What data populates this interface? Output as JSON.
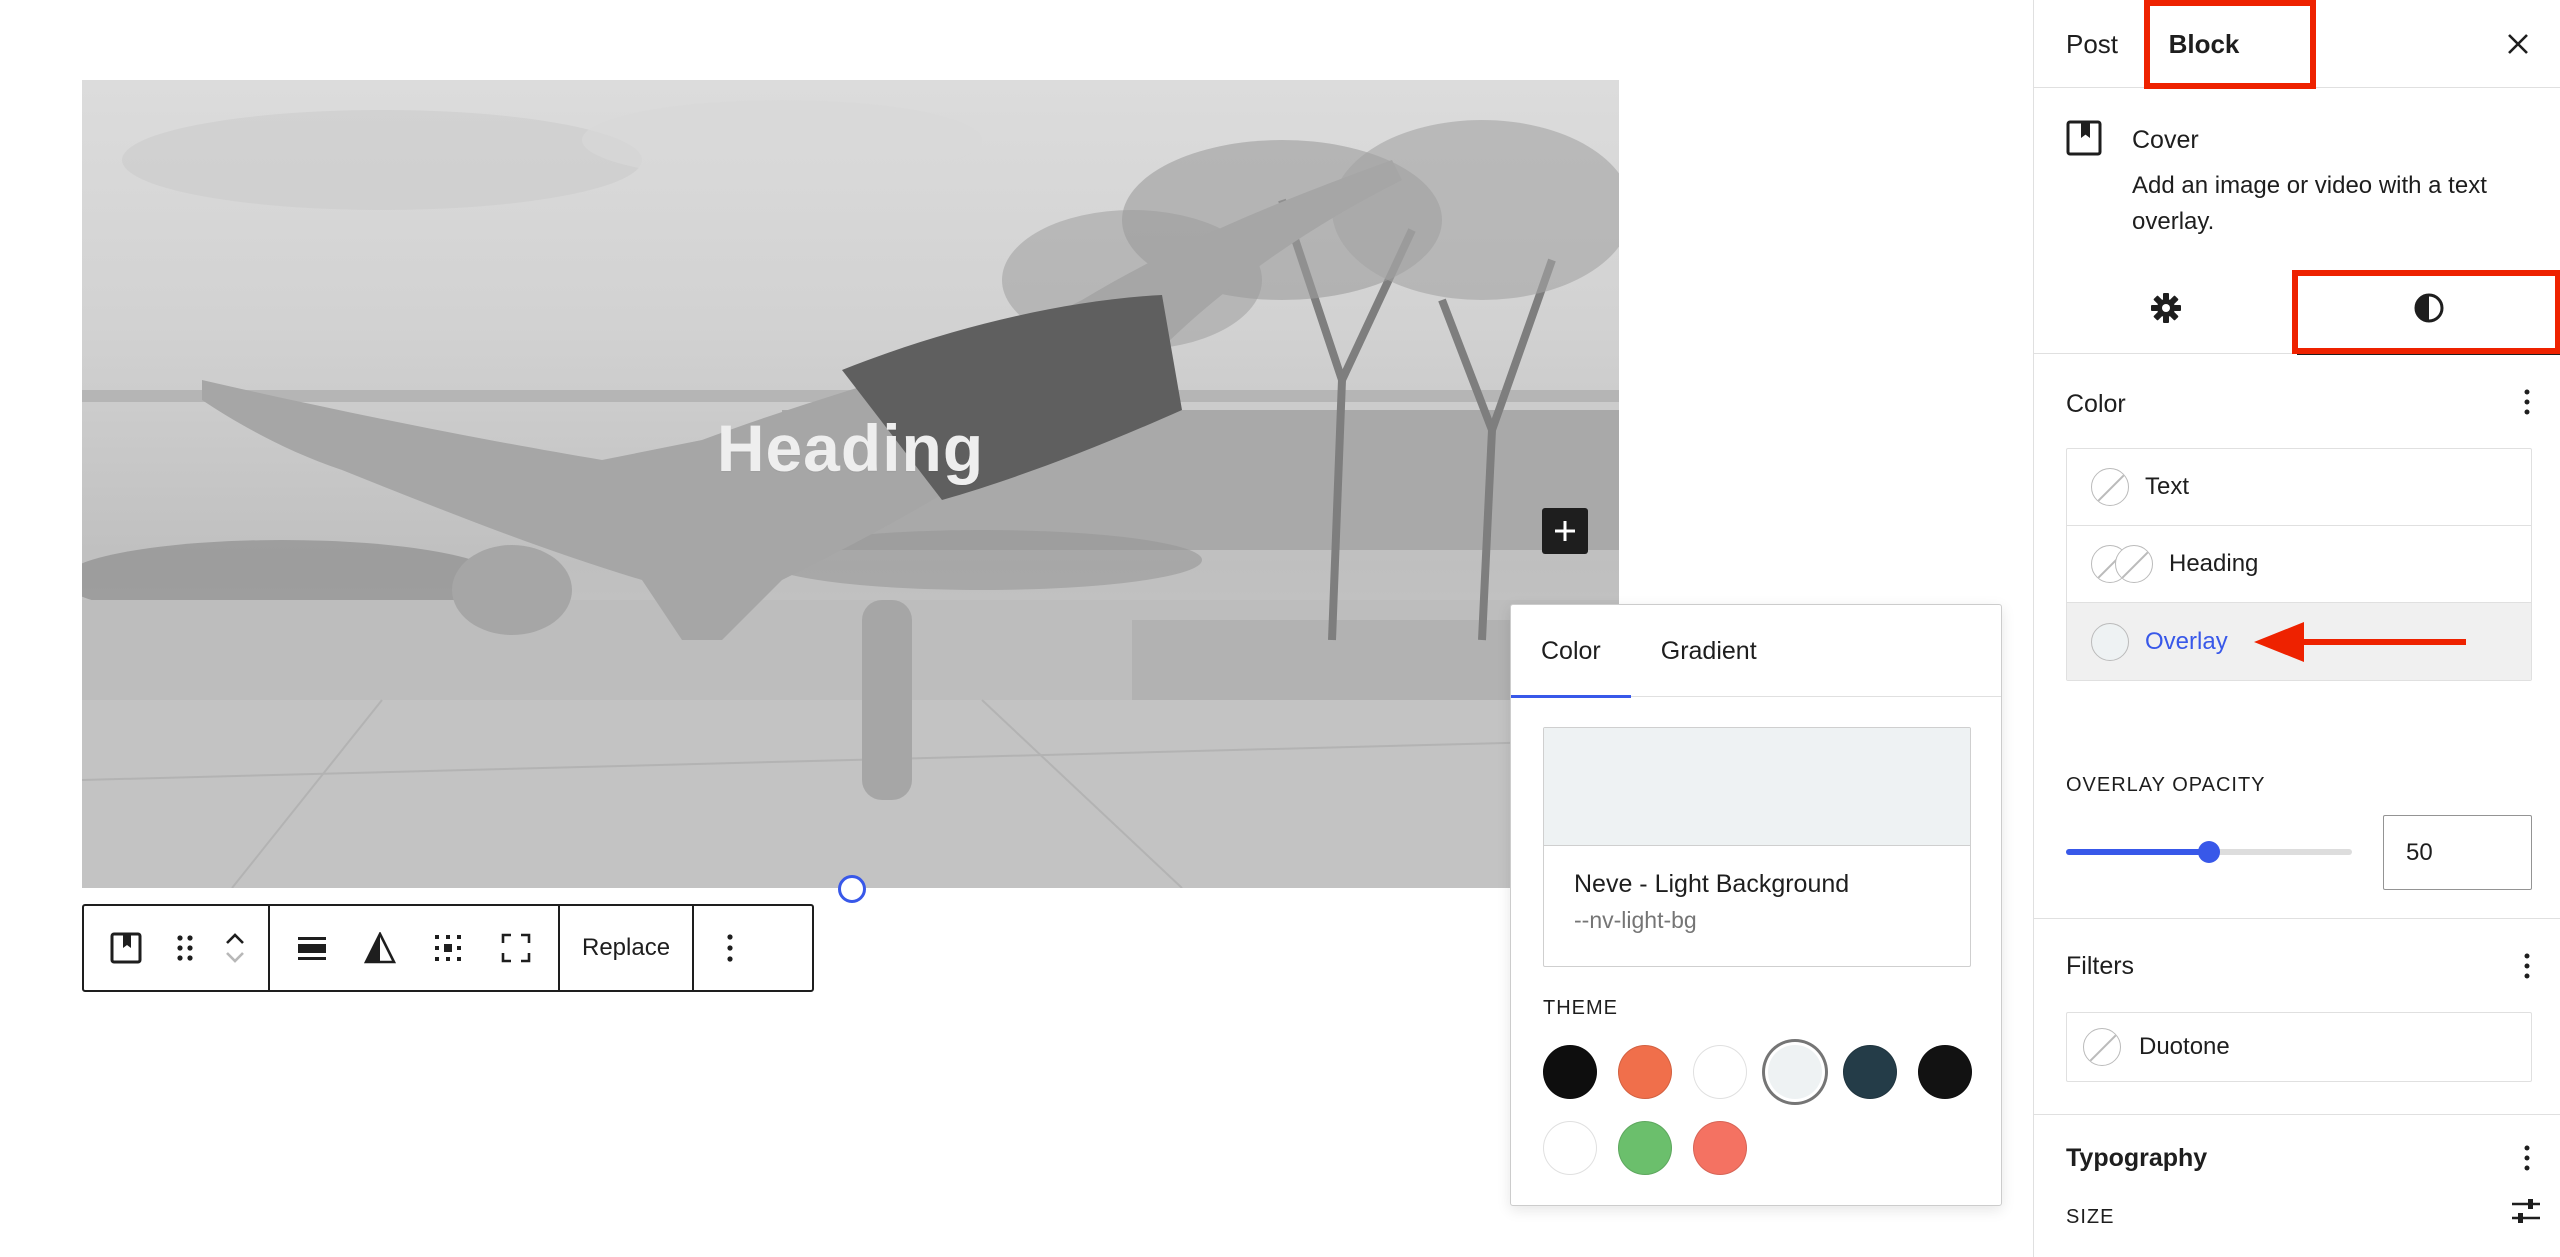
{
  "canvas": {
    "cover_heading": "Heading"
  },
  "toolbar": {
    "replace_label": "Replace"
  },
  "popover": {
    "tabs": [
      {
        "label": "Color",
        "active": true
      },
      {
        "label": "Gradient",
        "active": false
      }
    ],
    "selected_color": {
      "name": "Neve - Light Background",
      "variable": "--nv-light-bg",
      "hex": "#eef2f3"
    },
    "theme_label": "THEME",
    "swatches": [
      "#0e0e0e",
      "#f06f4b",
      "#ffffff",
      "#eef2f3",
      "#243c48",
      "#121212",
      "#ffffff",
      "#6bbf6c",
      "#f47262"
    ]
  },
  "sidebar": {
    "tabs": {
      "post": "Post",
      "block": "Block"
    },
    "block": {
      "name": "Cover",
      "description": "Add an image or video with a text overlay."
    },
    "color": {
      "title": "Color",
      "items": {
        "text": "Text",
        "heading": "Heading",
        "overlay": "Overlay"
      }
    },
    "overlay_opacity": {
      "label": "OVERLAY OPACITY",
      "value": "50",
      "percent": 50
    },
    "filters": {
      "title": "Filters",
      "duotone": "Duotone"
    },
    "typography": {
      "title": "Typography",
      "size_label": "SIZE"
    }
  },
  "colors": {
    "accent": "#3858e9",
    "annotation": "#ee2200"
  }
}
